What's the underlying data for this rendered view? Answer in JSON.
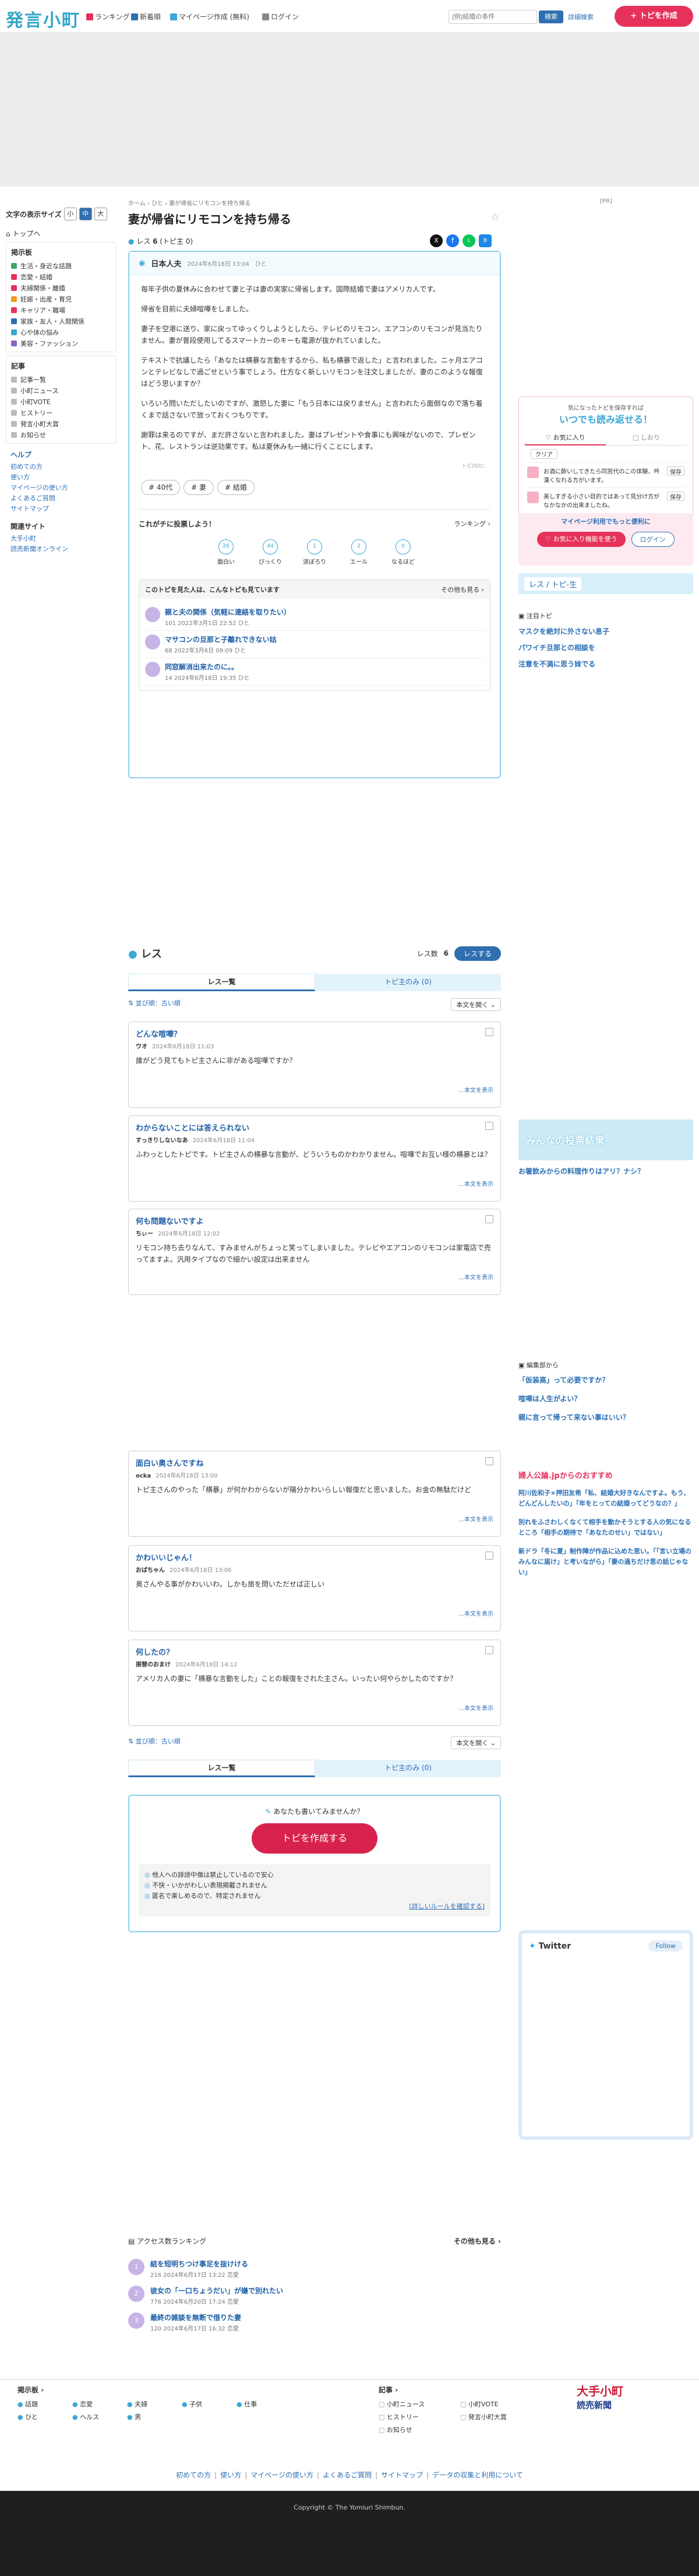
{
  "header": {
    "logo": "発言小町",
    "nav": [
      "ランキング",
      "新着順",
      "マイページ作成 (無料)",
      "ログイン"
    ],
    "search_placeholder": "(例)結婚の条件",
    "search_button": "検索",
    "detail_search": "詳細検索",
    "post_button": "+ トピを作成"
  },
  "sidebar": {
    "font_size_label": "文字の表示サイズ",
    "font_sizes": [
      "小",
      "中",
      "大"
    ],
    "top_link": "トップへ",
    "genre_title": "掲示板",
    "genres": [
      {
        "label": "生活・身近な話題",
        "color": "#3ca86a"
      },
      {
        "label": "恋愛・結婚",
        "color": "#e6325a"
      },
      {
        "label": "夫婦関係・離婚",
        "color": "#e6325a"
      },
      {
        "label": "妊娠・出産・育児",
        "color": "#f19b1e"
      },
      {
        "label": "キャリア・職場",
        "color": "#e6325a"
      },
      {
        "label": "家族・友人・人間関係",
        "color": "#2f6fb0"
      },
      {
        "label": "心や体の悩み",
        "color": "#3aa7d6"
      },
      {
        "label": "美容・ファッション",
        "color": "#8b63c1"
      }
    ],
    "article_title": "記事",
    "articles": [
      "記事一覧",
      "小町ニュース",
      "小町VOTE",
      "ヒストリー",
      "発言小町大賞",
      "お知らせ"
    ],
    "help_title": "ヘルプ",
    "help": [
      "初めての方",
      "使い方",
      "マイページの使い方",
      "よくあるご質問",
      "サイトマップ"
    ],
    "related_title": "関連サイト",
    "related": [
      "大手小町",
      "読売新聞オンライン"
    ]
  },
  "topic": {
    "breadcrumb": [
      "ホーム",
      "ひと",
      "妻が帰省にリモコンを持ち帰る"
    ],
    "pr_label": "[PR]",
    "title": "妻が帰省にリモコンを持ち帰る",
    "res_count_label": "レス",
    "res_count": "6",
    "topi_count": "(トピ主 0)",
    "author": "日本人夫",
    "date": "2024年6月18日 13:04",
    "category": "ひと",
    "body": [
      "毎年子供の夏休みに合わせて妻と子は妻の実家に帰省します。国際結婚で妻はアメリカ人です。",
      "帰省を目前に夫婦喧嘩をしました。",
      "妻子を空港に送り、家に戻ってゆっくりしようとしたら、テレビのリモコン、エアコンのリモコンが見当たりません。妻が普段使用してるスマートカーのキーも電源が抜かれていました。",
      "テキストで抗議したら「あなたは横暴な言動をするから、私も横暴で返した」と言われました。ニヶ月エアコンとテレビなしで過ごせという事でしょう。仕方なく新しいリモコンを注文しましたが、妻のこのような報復はどう思いますか？",
      "いろいろ問いただしたいのですが、激怒した妻に「もう日本には戻りません」と言われたら面倒なので落ち着くまで話さないで放っておくつもりです。",
      "謝罪は来るのですが、まだ許さないと言われました。妻はプレゼントや食事にも興味がないので、プレゼント、花、レストランは逆効果です。私は夏休みも一緒に行くことにします。"
    ],
    "trailer": "トピ内ID：",
    "tags": [
      "# 40代",
      "# 妻",
      "# 結婚"
    ],
    "reaction_title": "これがチに投票しよう！",
    "ranking_link": "ランキング",
    "reactions": [
      {
        "label": "面白い",
        "count": "26"
      },
      {
        "label": "びっくり",
        "count": "44"
      },
      {
        "label": "涙ぽろり",
        "count": "1"
      },
      {
        "label": "エール",
        "count": "2"
      },
      {
        "label": "なるほど",
        "count": "0"
      }
    ],
    "related_title": "このトピを見た人は、こんなトピも見ています",
    "related_more": "その他も見る",
    "related": [
      {
        "title": "親と夫の関係（気軽に連絡を取りたい）",
        "meta": "101  2022年3月1日 22:52  ひと"
      },
      {
        "title": "マサコンの旦那と子離れできない姑",
        "meta": "68  2022年3月6日 09:09  ひと"
      },
      {
        "title": "同窓解消出来たのに。。",
        "meta": "14  2024年6月18日 19:35  ひと"
      }
    ]
  },
  "right": {
    "bookmark_text": "気になったトピを保存すれば",
    "bookmark_headline": "いつでも読み返せる！",
    "fav_tab": "お気に入り",
    "shiori_tab": "しおり",
    "clear": "クリア",
    "favs": [
      {
        "text": "お酒に酔いしてきたら同窓代のこの体験、吟漢くなれる方がいます。",
        "btn": "保存"
      },
      {
        "text": "美しすぎる小さい目的ではあって見分け方がなかなかの出来ましたね。",
        "btn": "保存"
      }
    ],
    "mypage_banner": "マイページ利用でもっと便利に",
    "fav_button": "お気に入り機能を使う",
    "login_button": "ログイン",
    "res_tab": "レス",
    "topi_tab": "トピ-生",
    "attention_title": "注目トピ",
    "attention": [
      "マスクを絶対に外さない息子",
      "パワイチ旦那との相談を",
      "注意を不満に思う妹でる"
    ],
    "vote_banner": "みんなの投票結果",
    "vote_q": "お箸飲みからの料理作りはアリ？ナシ？",
    "editor_title": "編集部から",
    "editor": [
      "「仮装高」って必要ですか？",
      "喧嘩は人生がよい？",
      "親に言って帰って来ない事はいい？"
    ],
    "ad_title": "婦人公論.jpからのおすすめ",
    "ad_items": [
      "阿川佐和子×押田友希「私、結婚大好きなんですよ。もう、どんどんしたいの」「年をとっての結婚ってどうなの？」",
      "別れをふさわしくなくて相手を動かそうとする人の気になるところ「相手の期待で「あなたのせい」ではない」",
      "新ドラ「冬に夏」制作陣が作品に込めた思い。「「言い立場のみんなに届け」と考いながら」「妻の過ちだけ思の話じゃない」"
    ],
    "twitter_title": "Twitter",
    "twitter_follow": "Follow"
  },
  "res": {
    "title": "レス",
    "count_label": "レス数",
    "count": "6",
    "write_button": "レスする",
    "tab_all": "レス一覧",
    "tab_topi": "トピ主のみ",
    "topi_count": "0",
    "sort_label": "並び順：古い順",
    "expand_label": "本文を開く",
    "items": [
      {
        "title": "どんな喧嘩？",
        "user": "ウオ",
        "date": "2024年6月18日 11:03",
        "body": "誰がどう見てもトピ主さんに非がある喧嘩ですか？",
        "more": "…本文を表示"
      },
      {
        "title": "わからないことには答えられない",
        "user": "すっきりしないなあ",
        "date": "2024年6月18日 11:04",
        "body": "ふわっとしたトピです。トピ主さんの横暴な言動が、どういうものかわかりません。喧嘩でお互い様の横暴とは？",
        "more": "…本文を表示"
      },
      {
        "title": "何も問題ないですよ",
        "user": "ちぃー",
        "date": "2024年6月18日 12:02",
        "body": "リモコン持ち去りなんて、すみませんがちょっと笑ってしまいました。テレビやエアコンのリモコンは家電店で売ってますよ。汎用タイプなので細かい設定は出来ません",
        "more": "…本文を表示"
      },
      {
        "title": "面白い奥さんですね",
        "user": "ocka",
        "date": "2024年6月18日 13:00",
        "body": "トピ主さんのやった「横暴」が何かわからないが陽分かわいらしい報復だと思いました。お金の無駄だけど",
        "more": "…本文を表示"
      },
      {
        "title": "かわいいじゃん！",
        "user": "おばちゃん",
        "date": "2024年6月18日 13:06",
        "body": "奥さんやる事がかわいいわ。しかも旅を問いただせば正しい",
        "more": "…本文を表示"
      },
      {
        "title": "何したの？",
        "user": "振替のおまけ",
        "date": "2024年6月18日 14:12",
        "body": "アメリカ人の妻に「横暴な言動をした」ことの報復をされた主さん。いったい何やらかしたのですか？",
        "more": "…本文を表示"
      }
    ],
    "cta_small": "あなたも書いてみませんか？",
    "cta_button": "トピを作成する",
    "rules": [
      "他人への誹謗中傷は禁止しているので安心",
      "不快・いかがわしい表現掲載されません",
      "匿名で楽しめるので、特定されません"
    ],
    "rules_link": "[詳しいルールを確認する]"
  },
  "ranking": {
    "title": "アクセス数ランキング",
    "more": "その他も見る",
    "items": [
      {
        "title": "結を短明ちつけ事足を抜けける",
        "meta": "216  2024年6月17日 13:22  恋愛"
      },
      {
        "title": "彼女の「一口ちょうだい」が嫌で別れたい",
        "meta": "776  2024年6月20日 17:24  恋愛"
      },
      {
        "title": "最終の雑談を無断で借りた妻",
        "meta": "120  2024年6月17日 16:32  恋愛"
      }
    ]
  },
  "footer": {
    "board_title": "掲示板",
    "boards": [
      "話題",
      "恋愛",
      "夫婦",
      "子供",
      "仕事",
      "ひと",
      "ヘルス",
      "男"
    ],
    "article_title": "記事",
    "articles": [
      "小町ニュース",
      "小町VOTE",
      "ヒストリー",
      "発言小町大賞",
      "お知らせ"
    ],
    "brand1": "大手小町",
    "brand2": "読売新聞",
    "links": [
      "初めての方",
      "使い方",
      "マイページの使い方",
      "よくあるご質問",
      "サイトマップ",
      "データの収集と利用について"
    ],
    "copyright": "Copyright © The Yomiuri Shimbun."
  }
}
